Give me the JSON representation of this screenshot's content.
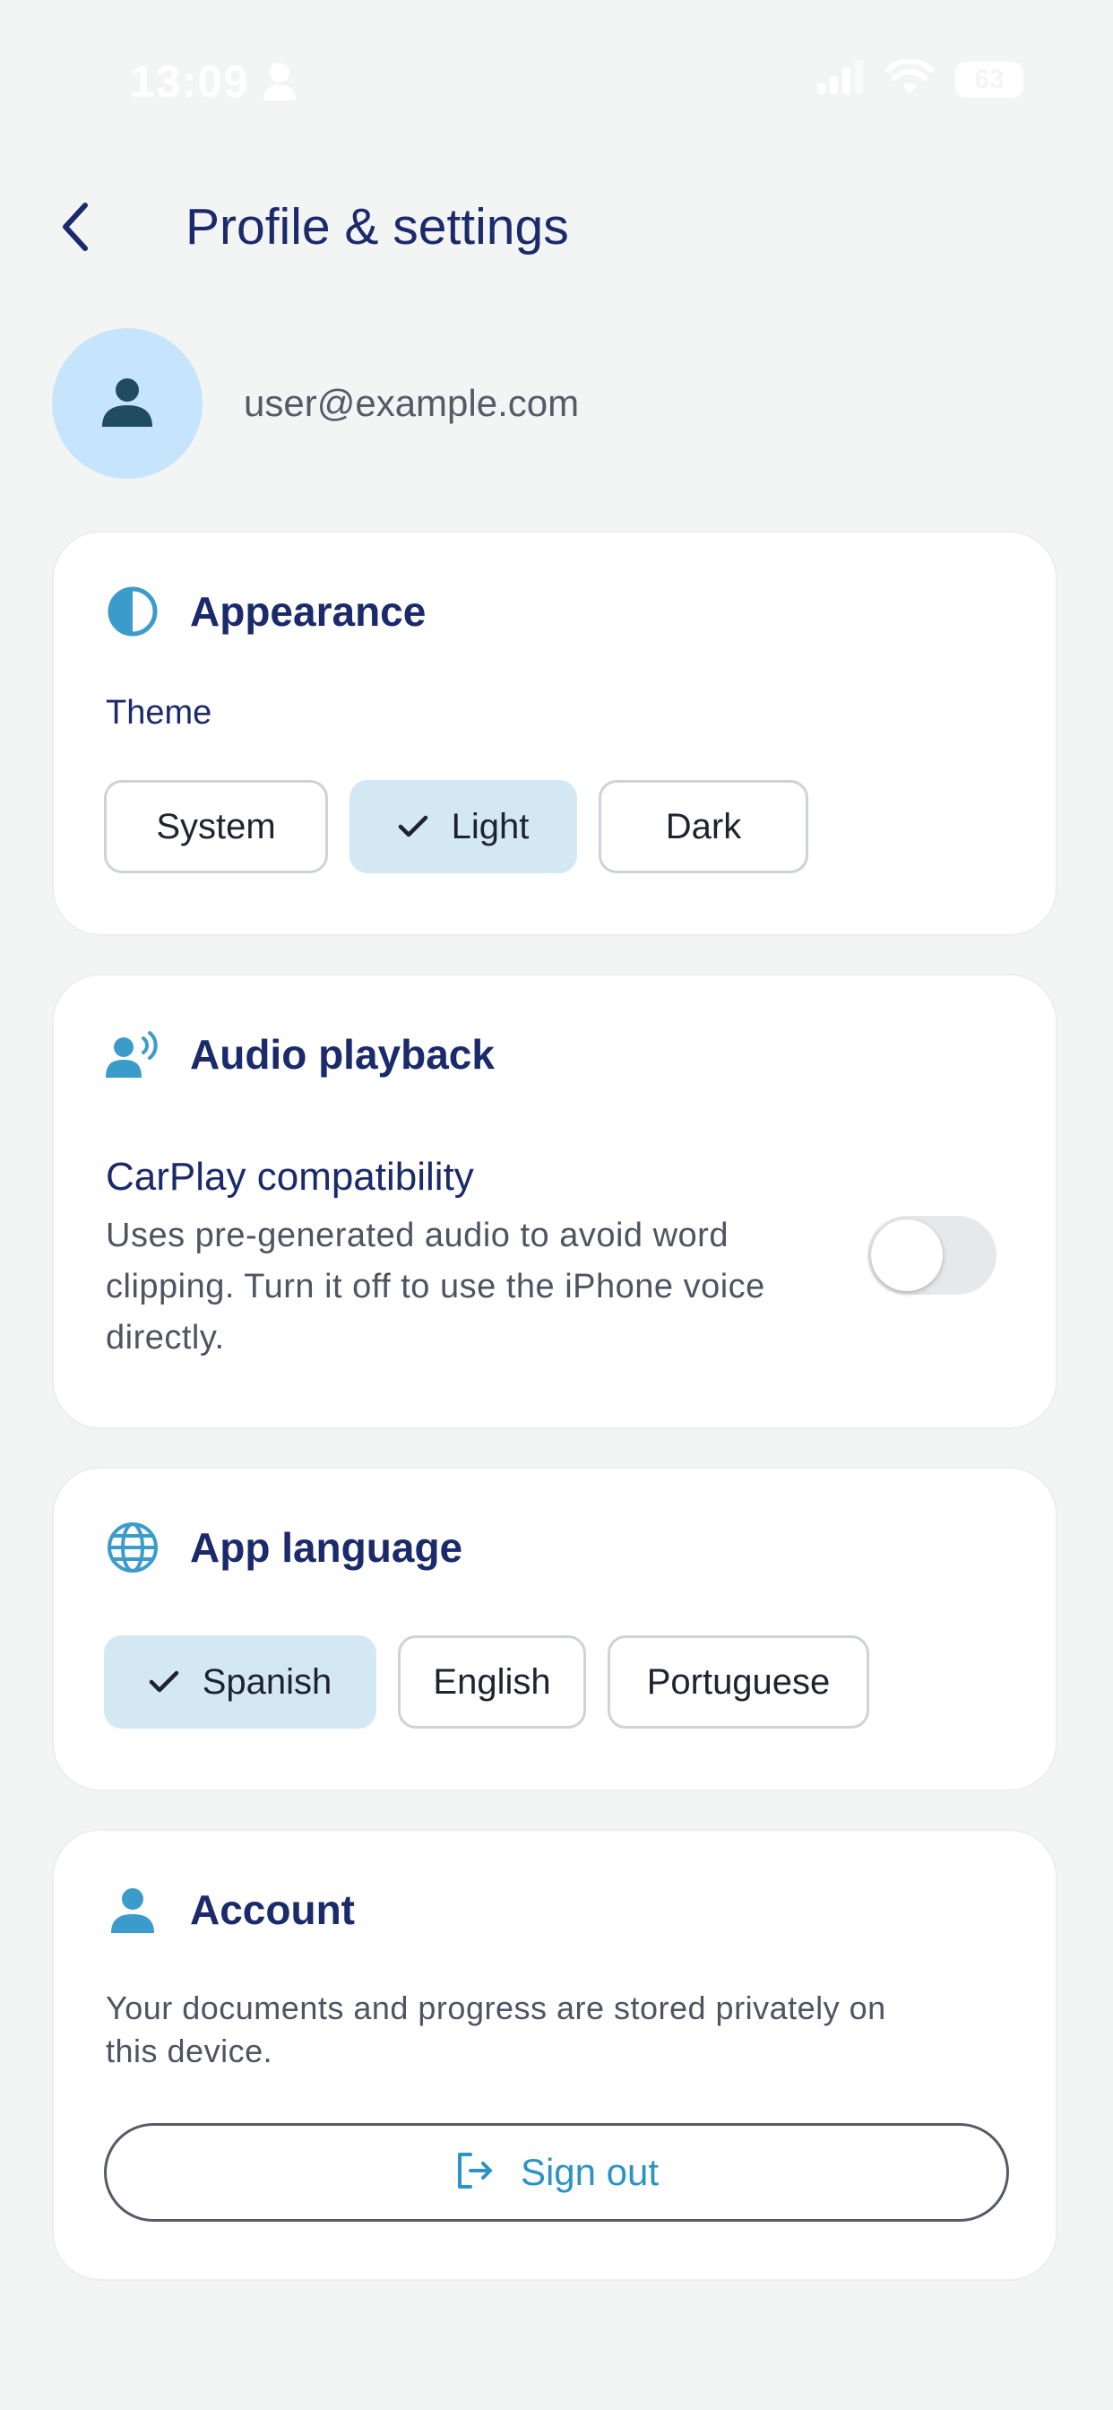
{
  "status_bar": {
    "time": "13:09",
    "battery": "63",
    "icons": [
      "person-icon",
      "signal-icon",
      "wifi-icon",
      "battery-icon"
    ]
  },
  "header": {
    "title": "Profile & settings",
    "back_icon": "chevron-left-icon"
  },
  "profile": {
    "email": "user@example.com",
    "avatar_icon": "person-icon"
  },
  "appearance": {
    "title": "Appearance",
    "icon": "contrast-icon",
    "theme_label": "Theme",
    "options": [
      {
        "label": "System",
        "selected": false
      },
      {
        "label": "Light",
        "selected": true
      },
      {
        "label": "Dark",
        "selected": false
      }
    ]
  },
  "audio": {
    "title": "Audio playback",
    "icon": "speaking-person-icon",
    "setting_title": "CarPlay compatibility",
    "setting_description": "Uses pre-generated audio to avoid word clipping. Turn it off to use the iPhone voice directly.",
    "enabled": false
  },
  "language": {
    "title": "App language",
    "icon": "globe-icon",
    "options": [
      {
        "label": "Spanish",
        "selected": true
      },
      {
        "label": "English",
        "selected": false
      },
      {
        "label": "Portuguese",
        "selected": false
      }
    ]
  },
  "account": {
    "title": "Account",
    "icon": "person-icon",
    "description": "Your documents and progress are stored privately on this device.",
    "sign_out_label": "Sign out",
    "sign_out_icon": "sign-out-icon"
  },
  "colors": {
    "background": "#f3f4f4",
    "title_navy": "#1a2a6b",
    "accent_blue": "#2d93c4",
    "selected_chip": "#d4e8f3",
    "avatar_bg": "#c6e5fc"
  }
}
